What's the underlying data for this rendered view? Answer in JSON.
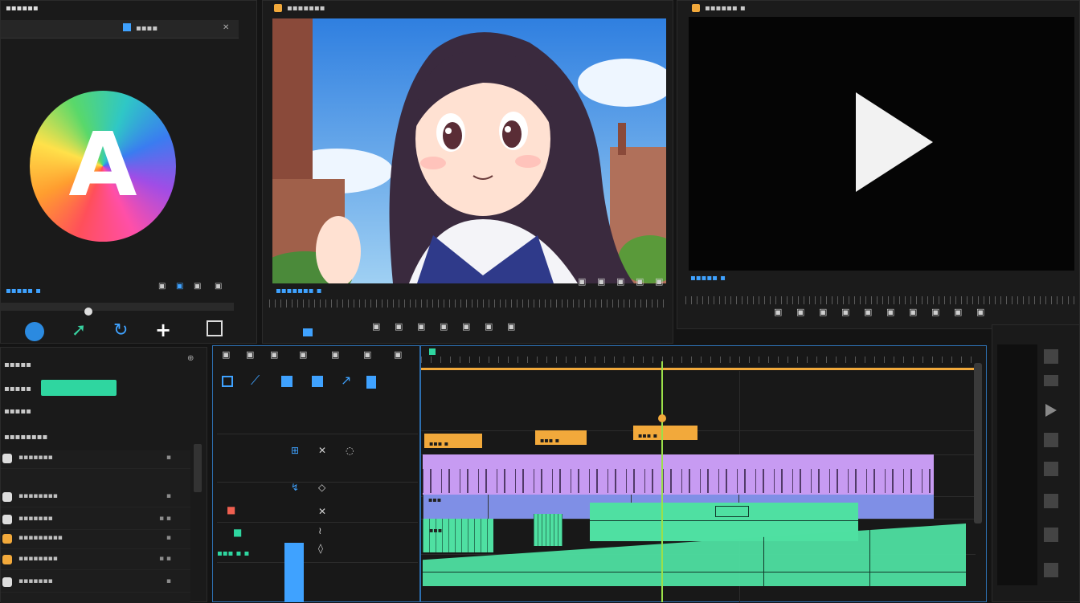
{
  "colors": {
    "accent_blue": "#3fa2ff",
    "playhead_green": "#9be04a",
    "clip_purple": "#c79bf2",
    "clip_blue": "#7f8fe6",
    "clip_green": "#4fe0a2",
    "marker_orange": "#f2a93b",
    "button_green": "#2fd6a0"
  },
  "left_panel": {
    "title": "▪▪▪▪▪▪",
    "tab_label": "▪▪▪▪",
    "logo_letter": "A",
    "footer_label": "▪▪▪▪▪ ▪",
    "footer_icons": [
      "▣",
      "▣",
      "▣",
      "▣"
    ],
    "tools": [
      "shape-icon",
      "arrow-icon",
      "refresh-icon",
      "plus-icon",
      "square-icon"
    ]
  },
  "source_monitor": {
    "title": "▪▪▪▪▪▪▪",
    "label": "▪▪▪▪▪▪▪ ▪",
    "controls": [
      "▣",
      "▣",
      "▣",
      "▣",
      "▣",
      "▣",
      "▣",
      "▣",
      "▣",
      "▣",
      "▣",
      "▣"
    ]
  },
  "program_monitor": {
    "title": "▪▪▪▪▪▪ ▪",
    "label": "▪▪▪▪▪ ▪",
    "controls": [
      "▣",
      "▣",
      "▣",
      "▣",
      "▣",
      "▣",
      "▣",
      "▣",
      "▣",
      "▣"
    ]
  },
  "effects_panel": {
    "title": "▪▪▪▪▪",
    "row1": "▪▪▪▪▪",
    "row2": "▪▪▪▪▪",
    "button": "",
    "section": "▪▪▪▪▪▪▪▪",
    "items": [
      {
        "label": "▪▪▪▪▪▪▪",
        "right": "▪"
      },
      {
        "label": "▪▪▪▪▪▪▪▪",
        "right": "▪"
      },
      {
        "label": "▪▪▪▪▪▪▪",
        "right": "▪ ▪"
      },
      {
        "label": "▪▪▪▪▪▪▪▪▪",
        "right": "▪"
      },
      {
        "label": "▪▪▪▪▪▪▪▪",
        "right": "▪ ▪"
      },
      {
        "label": "▪▪▪▪▪▪▪",
        "right": "▪"
      }
    ]
  },
  "timeline": {
    "header_tools": [
      "▣",
      "▣",
      "▣",
      "▣",
      "▣",
      "▣",
      "▣"
    ],
    "markers": [
      "▪▪▪ ▪",
      "▪▪▪ ▪",
      "▪▪▪ ▪"
    ],
    "track_labels": [
      "▪▪▪",
      "▪▪▪",
      "▪▪▪"
    ],
    "bottom_label": "▪▪▪ ▪ ▪"
  }
}
